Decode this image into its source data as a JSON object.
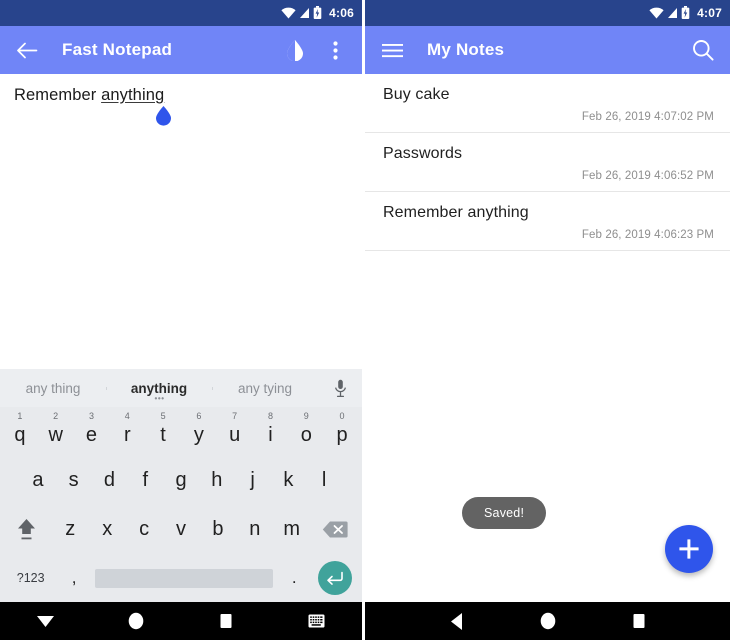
{
  "editor_screen": {
    "statusbar": {
      "time": "4:06",
      "icons": [
        "wifi-icon",
        "signal-icon",
        "battery-icon"
      ]
    },
    "appbar": {
      "back_icon": "back-arrow-icon",
      "title": "Fast Notepad",
      "theme_icon": "contrast-droplet-icon",
      "overflow_icon": "overflow-menu-icon"
    },
    "note": {
      "text_before": "Remember ",
      "text_misspelled": "anything",
      "cursor_handle": "text-cursor-handle"
    },
    "keyboard": {
      "suggestions": [
        {
          "label": "any thing",
          "active": false
        },
        {
          "label": "anything",
          "active": true
        },
        {
          "label": "any tying",
          "active": false
        }
      ],
      "mic_icon": "microphone-icon",
      "row1": [
        {
          "key": "q",
          "num": "1"
        },
        {
          "key": "w",
          "num": "2"
        },
        {
          "key": "e",
          "num": "3"
        },
        {
          "key": "r",
          "num": "4"
        },
        {
          "key": "t",
          "num": "5"
        },
        {
          "key": "y",
          "num": "6"
        },
        {
          "key": "u",
          "num": "7"
        },
        {
          "key": "i",
          "num": "8"
        },
        {
          "key": "o",
          "num": "9"
        },
        {
          "key": "p",
          "num": "0"
        }
      ],
      "row2": [
        "a",
        "s",
        "d",
        "f",
        "g",
        "h",
        "j",
        "k",
        "l"
      ],
      "row3": [
        "z",
        "x",
        "c",
        "v",
        "b",
        "n",
        "m"
      ],
      "shift_icon": "shift-icon",
      "backspace_icon": "backspace-icon",
      "symbols_label": "?123",
      "comma": ",",
      "period": ".",
      "space_label": "",
      "enter_icon": "enter-icon"
    },
    "navbar": [
      "hide-keyboard-icon",
      "home-icon",
      "recents-icon",
      "keyboard-switch-icon"
    ]
  },
  "list_screen": {
    "statusbar": {
      "time": "4:07",
      "icons": [
        "wifi-icon",
        "signal-icon",
        "battery-icon"
      ]
    },
    "appbar": {
      "menu_icon": "hamburger-menu-icon",
      "title": "My Notes",
      "search_icon": "search-icon"
    },
    "notes": [
      {
        "title": "Buy cake",
        "date": "Feb 26, 2019 4:07:02 PM"
      },
      {
        "title": "Passwords",
        "date": "Feb 26, 2019 4:06:52 PM"
      },
      {
        "title": "Remember anything",
        "date": "Feb 26, 2019 4:06:23 PM"
      }
    ],
    "toast": {
      "message": "Saved!"
    },
    "fab": {
      "icon": "plus-icon"
    },
    "navbar": [
      "back-icon",
      "home-icon",
      "recents-icon"
    ]
  },
  "colors": {
    "statusbar": "#28448c",
    "appbar": "#7085f7",
    "fab": "#2f55eb",
    "enter_key": "#40a39b",
    "toast": "#636363",
    "keyboard_bg": "#e8eaed"
  }
}
